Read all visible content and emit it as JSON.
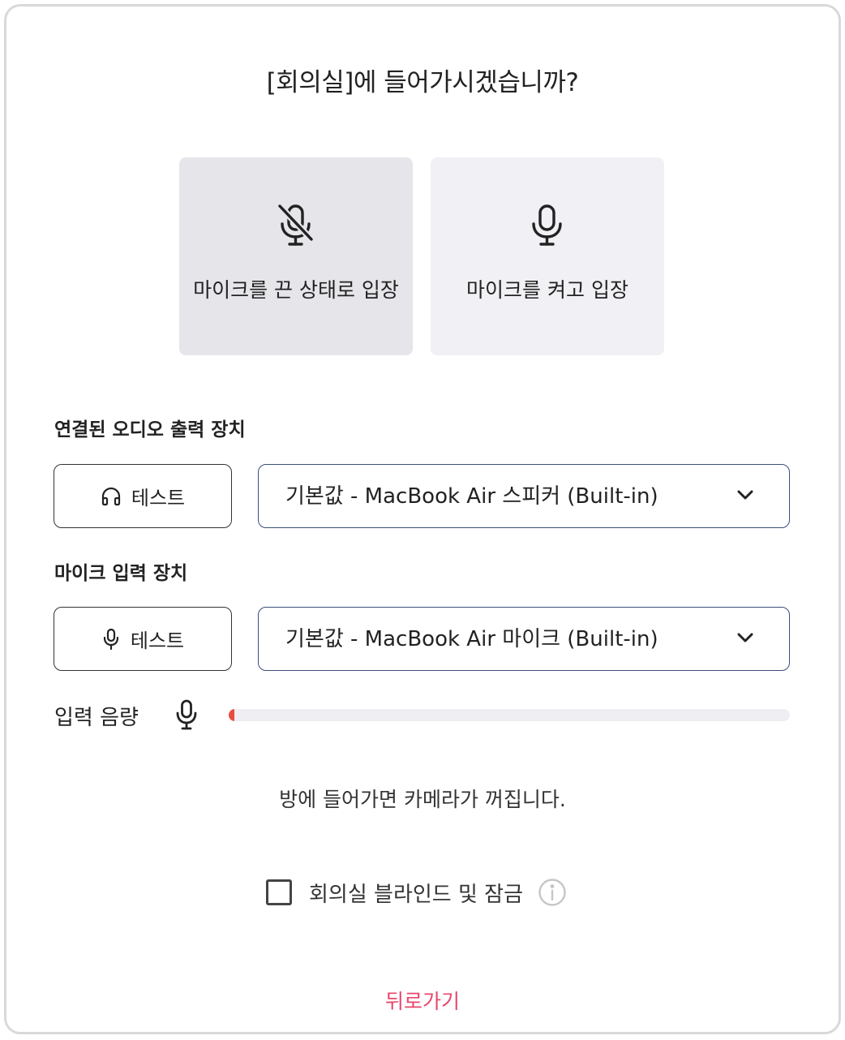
{
  "dialog": {
    "title": "[회의실]에 들어가시겠습니까?"
  },
  "mic_choices": {
    "off_label": "마이크를 끈 상태로 입장",
    "on_label": "마이크를 켜고 입장"
  },
  "audio_output": {
    "section_label": "연결된 오디오 출력 장치",
    "test_label": "테스트",
    "selected_device": "기본값 - MacBook Air 스피커 (Built-in)"
  },
  "mic_input": {
    "section_label": "마이크 입력 장치",
    "test_label": "테스트",
    "selected_device": "기본값 - MacBook Air 마이크 (Built-in)"
  },
  "input_volume": {
    "label": "입력 음량",
    "level_percent": 1
  },
  "camera_notice": "방에 들어가면 카메라가 꺼집니다.",
  "blind_lock": {
    "label": "회의실 블라인드 및 잠금",
    "checked": false
  },
  "back_label": "뒤로가기",
  "colors": {
    "accent_pink": "#e9476b",
    "volume_red": "#e94c3c",
    "select_border": "#3b4e7a"
  }
}
